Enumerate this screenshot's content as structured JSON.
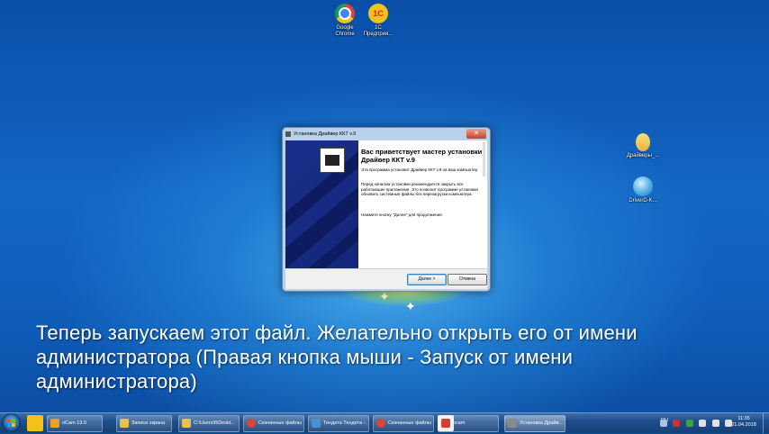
{
  "desktop": {
    "icons": [
      {
        "label_line1": "Google",
        "label_line2": "Chrome"
      },
      {
        "label_line1": "1С",
        "label_line2": "Предприя..."
      },
      {
        "label_line1": "Драйверы_...",
        "label_line2": ""
      },
      {
        "label_line1": "DriverD-K...",
        "label_line2": ""
      }
    ]
  },
  "installer": {
    "window_title": "Установка Драйвер ККТ v.9",
    "close_glyph": "✕",
    "heading": "Вас приветствует мастер установки Драйвер ККТ v.9",
    "para1": "Эта программа установит Драйвер ККТ v.9 на ваш компьютер.",
    "para2": "Перед началом установки рекомендуется закрыть все работающие приложения. Это позволит программе установки обновить системные файлы без перезагрузки компьютера.",
    "para3": "Нажмите кнопку \"Далее\" для продолжения.",
    "next_label": "Далее >",
    "cancel_label": "Отмена"
  },
  "caption": {
    "text": "Теперь запускаем этот файл. Желательно открыть его от имени администратора (Правая кнопка мыши - Запуск от имени администратора)"
  },
  "taskbar": {
    "items": [
      {
        "label": "oCam 13.0",
        "color": "#f0a020"
      },
      {
        "label": "Записи экрана",
        "color": "#e8c050"
      },
      {
        "label": "C:\\Users\\fi\\Deskt...",
        "color": "#e8c050"
      },
      {
        "label": "Скачанные файлы...",
        "color": "#db4437"
      },
      {
        "label": "Тендета Тендета -...",
        "color": "#4a90d0"
      },
      {
        "label": "Скачанные файлы...",
        "color": "#db4437"
      },
      {
        "label": "ocam",
        "color": "#d04030"
      },
      {
        "label": "Установка Драйв...",
        "color": "#8a8a8a"
      }
    ],
    "lang": "RU",
    "time": "11:35",
    "date": "21.04.2018"
  },
  "colors": {
    "accent": "#0f5cb8",
    "installer_side": "#1a2f8a"
  }
}
